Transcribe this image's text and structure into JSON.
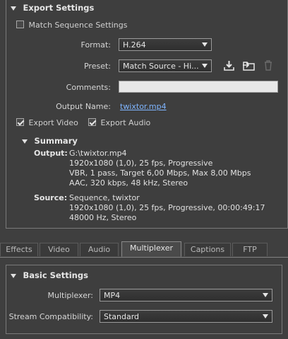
{
  "export_settings": {
    "header": "Export Settings",
    "match_sequence": {
      "label": "Match Sequence Settings",
      "checked": false
    },
    "format": {
      "label": "Format:",
      "value": "H.264"
    },
    "preset": {
      "label": "Preset:",
      "value": "Match Source - Hi..."
    },
    "comments": {
      "label": "Comments:",
      "value": ""
    },
    "output_name": {
      "label": "Output Name:",
      "value": "twixtor.mp4"
    },
    "export_video": {
      "label": "Export Video",
      "checked": true
    },
    "export_audio": {
      "label": "Export Audio",
      "checked": true
    },
    "summary": {
      "header": "Summary",
      "output_label": "Output:",
      "output_lines": [
        "G:\\twixtor.mp4",
        "1920x1080 (1,0), 25 fps, Progressive",
        "VBR, 1 pass, Target 6,00 Mbps, Max 8,00 Mbps",
        "AAC, 320 kbps, 48 kHz, Stereo"
      ],
      "source_label": "Source:",
      "source_lines": [
        "Sequence, twixtor",
        "1920x1080 (1,0), 25 fps, Progressive, 00:00:49:17",
        "48000 Hz, Stereo"
      ]
    },
    "icons": [
      "save-preset-icon",
      "import-preset-icon",
      "delete-preset-icon"
    ]
  },
  "tabs": [
    "Effects",
    "Video",
    "Audio",
    "Multiplexer",
    "Captions",
    "FTP"
  ],
  "active_tab": "Multiplexer",
  "basic_settings": {
    "header": "Basic Settings",
    "multiplexer": {
      "label": "Multiplexer:",
      "value": "MP4"
    },
    "stream_compat": {
      "label": "Stream Compatibility:",
      "value": "Standard"
    }
  }
}
